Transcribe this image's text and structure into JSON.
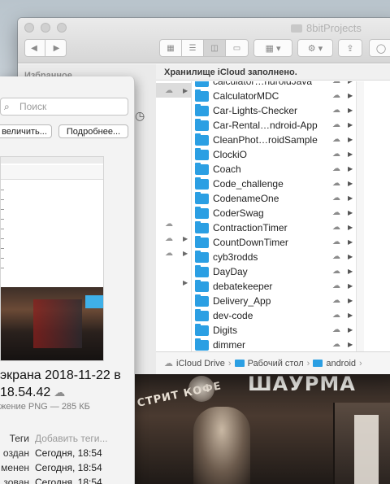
{
  "window": {
    "title": "8bitProjects"
  },
  "sidebar": {
    "heading": "Избранное"
  },
  "banner": {
    "text": "Хранилище iCloud заполнено."
  },
  "folders": [
    "calculator…ndroidJava",
    "CalculatorMDC",
    "Car-Lights-Checker",
    "Car-Rental…ndroid-App",
    "CleanPhot…roidSample",
    "ClockiO",
    "Coach",
    "Code_challenge",
    "CodenameOne",
    "CoderSwag",
    "ContractionTimer",
    "CountDownTimer",
    "cyb3rodds",
    "DayDay",
    "debatekeeper",
    "Delivery_App",
    "dev-code",
    "Digits",
    "dimmer"
  ],
  "pathbar": {
    "items": [
      "iCloud Drive",
      "Рабочий стол",
      "android"
    ],
    "separator": "›"
  },
  "preview": {
    "search_placeholder": "Поиск",
    "zoom_button": "величить...",
    "more_button": "Подробнее...",
    "file_title": "экрана 2018-11-22 в 18.54.42",
    "file_kind": "жение PNG — 285 КБ",
    "meta": [
      {
        "key": "Теги",
        "value": "Добавить теги...",
        "muted": true
      },
      {
        "key": "оздан",
        "value": "Сегодня, 18:54",
        "muted": false
      },
      {
        "key": "менен",
        "value": "Сегодня, 18:54",
        "muted": false
      },
      {
        "key": "зован",
        "value": "Сегодня, 18:54",
        "muted": false
      }
    ]
  },
  "wallpaper": {
    "sign_left": "СТРИТ КОФЕ",
    "sign_right": "ШАУРМА"
  },
  "icons": {
    "cloud": "☁",
    "disclosure": "▶",
    "search": "⌕",
    "gear": "⚙",
    "share": "⇪"
  },
  "colors": {
    "folder": "#2b9fe3",
    "selected_row": "#dcdcdc"
  }
}
